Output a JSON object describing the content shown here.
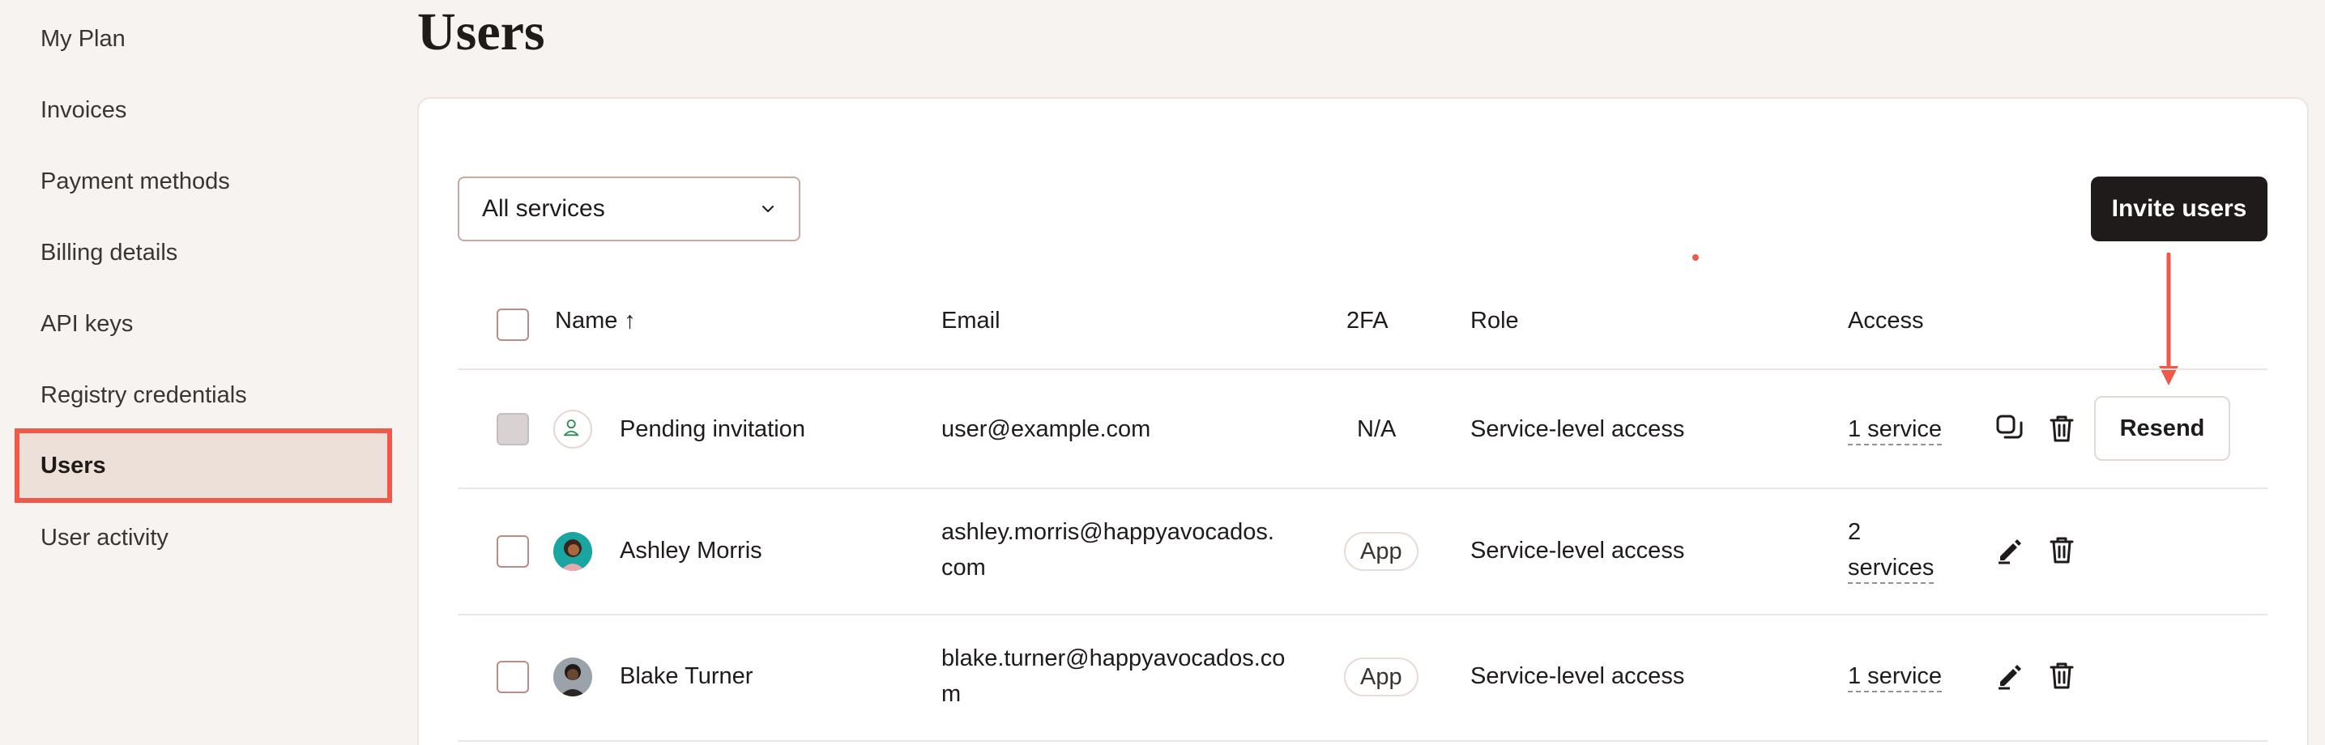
{
  "sidebar": {
    "items": [
      {
        "label": "My Plan"
      },
      {
        "label": "Invoices"
      },
      {
        "label": "Payment methods"
      },
      {
        "label": "Billing details"
      },
      {
        "label": "API keys"
      },
      {
        "label": "Registry credentials"
      },
      {
        "label": "Users",
        "active": true
      },
      {
        "label": "User activity"
      }
    ]
  },
  "page": {
    "title": "Users"
  },
  "filter": {
    "selected": "All services",
    "icon": "chevron-down-icon"
  },
  "actions": {
    "invite_label": "Invite users"
  },
  "annotations": {
    "highlight_color": "#f0584a",
    "arrow": "down-arrow-annotation"
  },
  "table": {
    "headers": {
      "name": "Name ↑",
      "email": "Email",
      "twofa": "2FA",
      "role": "Role",
      "access": "Access"
    },
    "rows": [
      {
        "name": "Pending invitation",
        "email": "user@example.com",
        "twofa": "N/A",
        "role": "Service‑level access",
        "access": "1 service",
        "avatar": "pending-user-icon",
        "actions": [
          "copy-icon",
          "trash-icon"
        ],
        "resend_label": "Resend"
      },
      {
        "name": "Ashley Morris",
        "email_line1": "ashley.morris@happyavocados.",
        "email_line2": "com",
        "twofa": "App",
        "role": "Service‑level access",
        "access_line1": "2",
        "access_line2": "services",
        "avatar": "avatar-photo",
        "actions": [
          "edit-icon",
          "trash-icon"
        ]
      },
      {
        "name": "Blake Turner",
        "email_line1": "blake.turner@happyavocados.co",
        "email_line2": "m",
        "twofa": "App",
        "role": "Service‑level access",
        "access": "1 service",
        "avatar": "avatar-photo",
        "actions": [
          "edit-icon",
          "trash-icon"
        ]
      }
    ]
  }
}
